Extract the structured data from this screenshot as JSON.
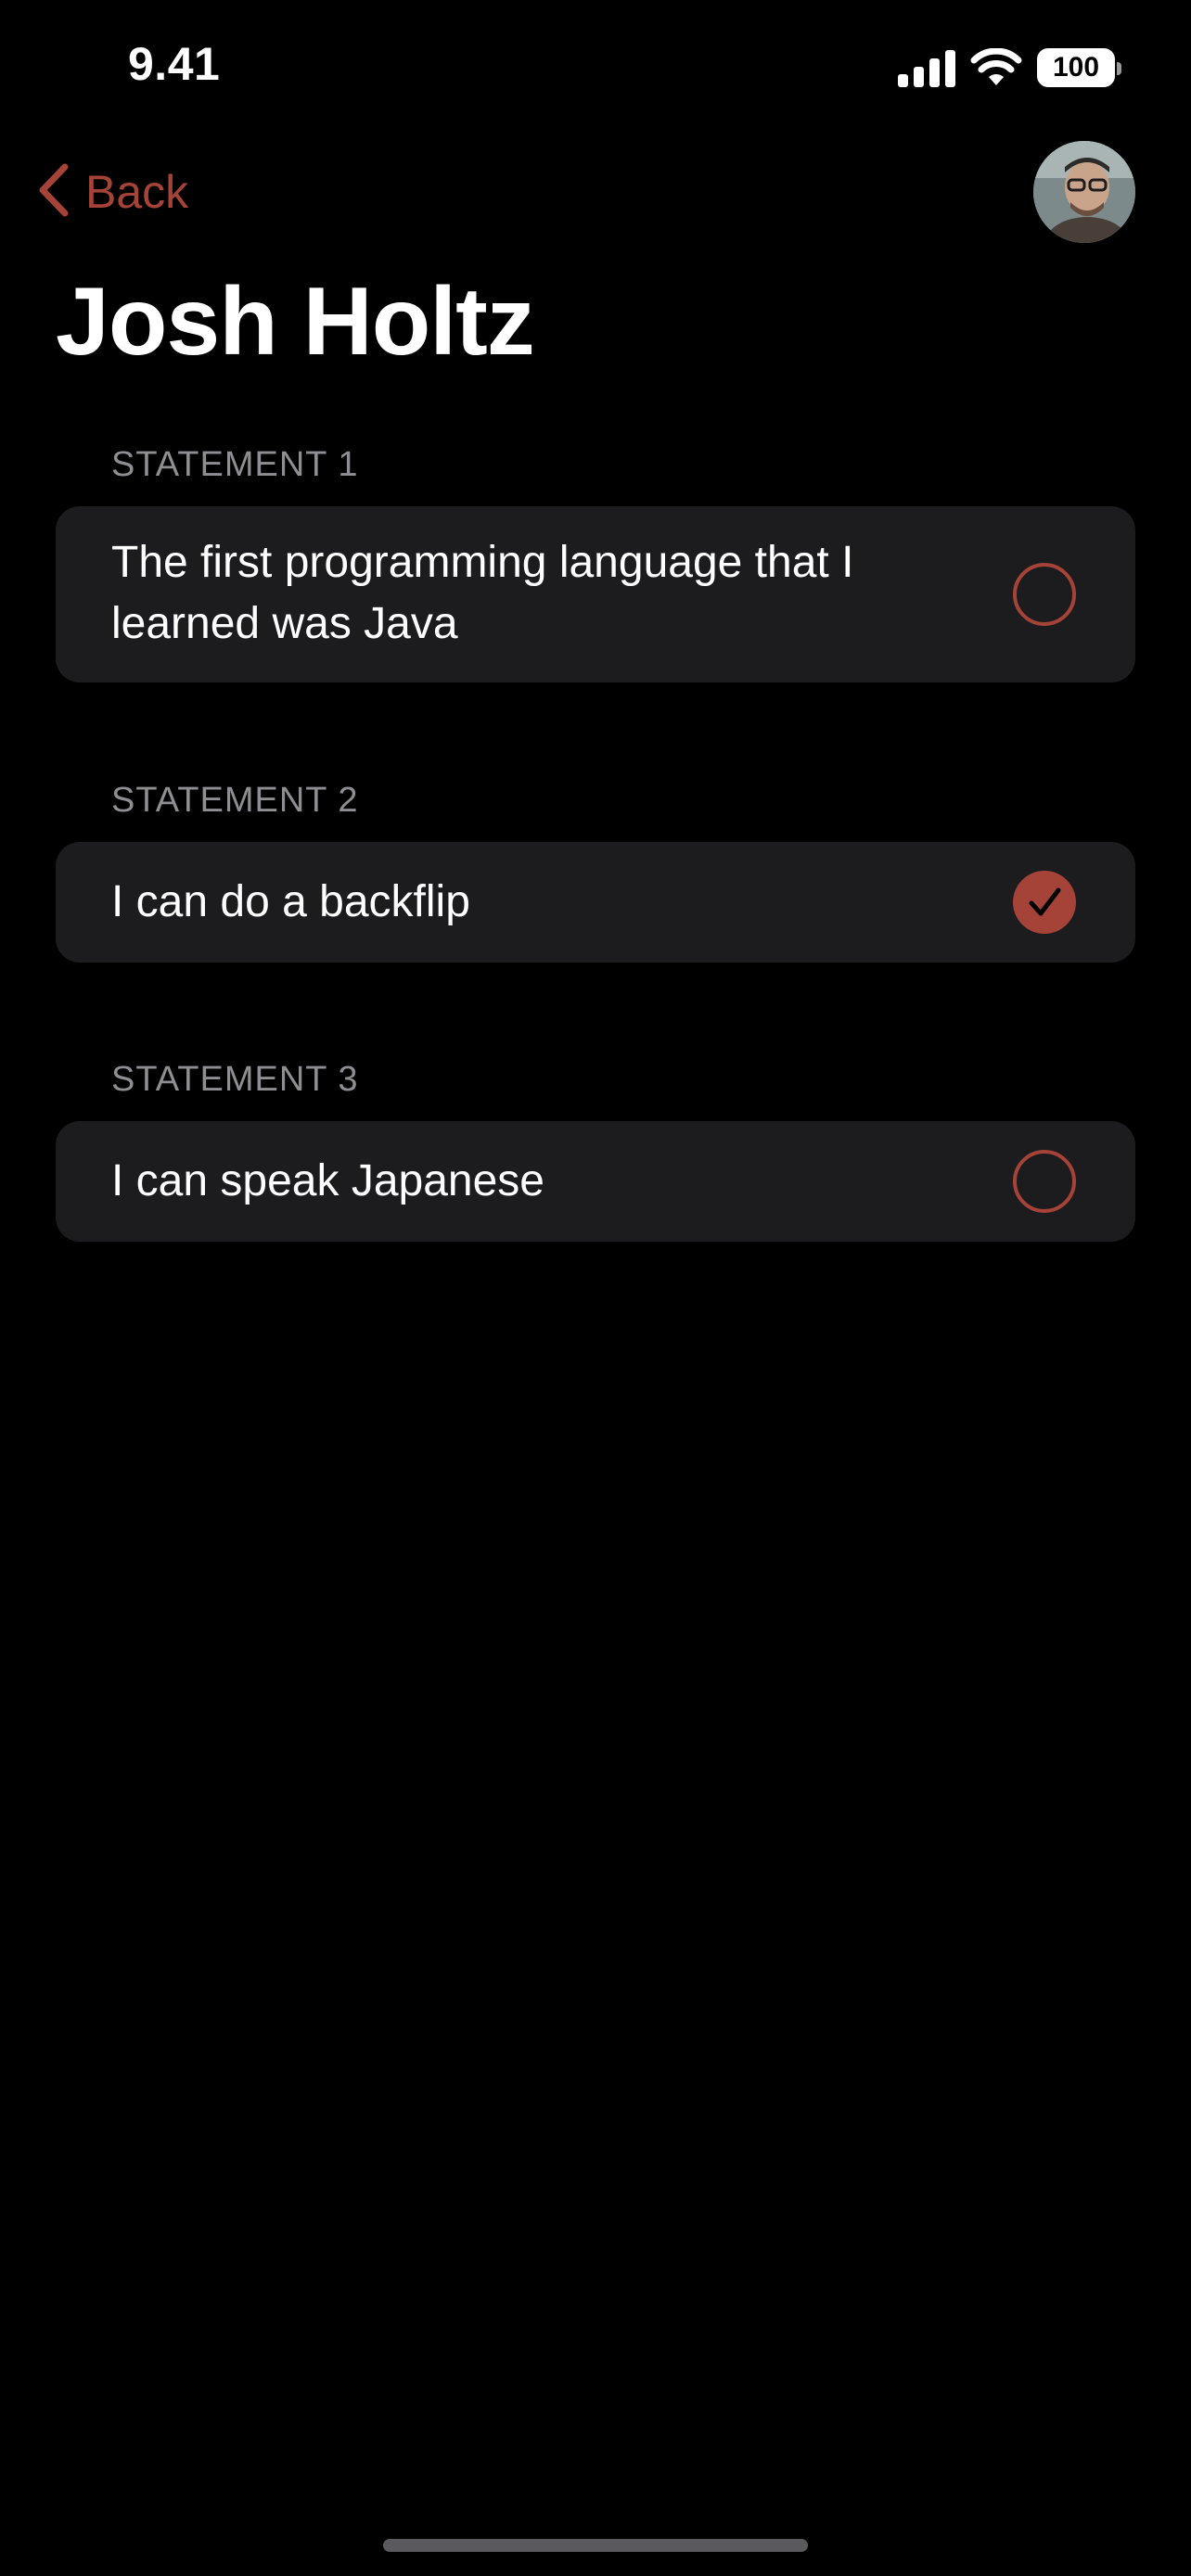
{
  "status_bar": {
    "time": "9.41",
    "battery": "100",
    "icons": [
      "signal-icon",
      "wifi-icon",
      "battery-icon"
    ]
  },
  "nav": {
    "back_label": "Back",
    "back_icon": "chevron-left-icon",
    "avatar": "profile-avatar"
  },
  "title": "Josh Holtz",
  "accent_color": "#a64338",
  "statements": [
    {
      "label": "STATEMENT 1",
      "text_line1": "The first programming language that I",
      "text_line2": "learned was Java",
      "selected": false
    },
    {
      "label": "STATEMENT 2",
      "text": "I can do a backflip",
      "selected": true
    },
    {
      "label": "STATEMENT 3",
      "text": "I can speak Japanese",
      "selected": false
    }
  ]
}
